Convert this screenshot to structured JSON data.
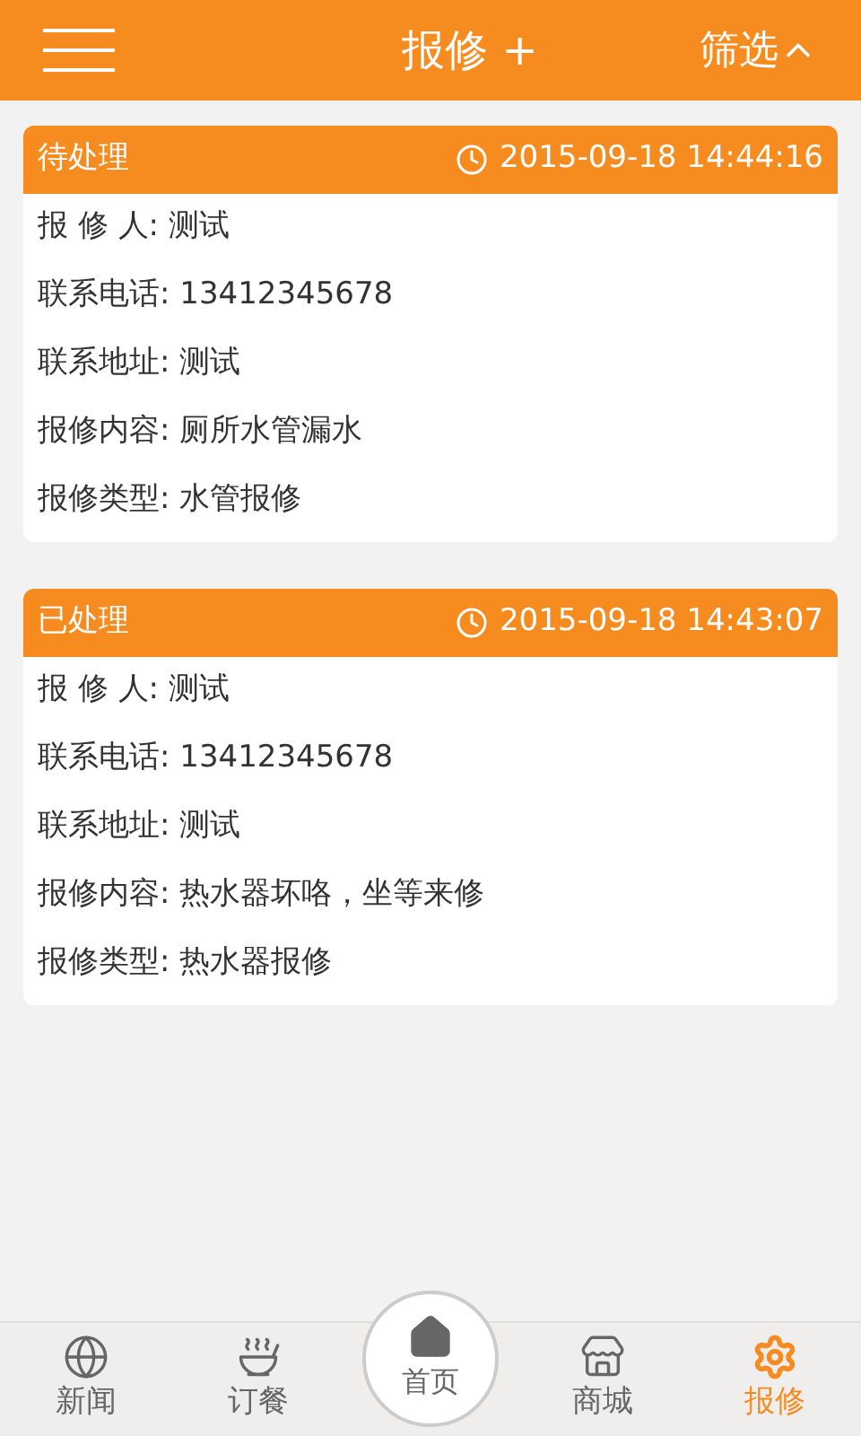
{
  "header": {
    "title": "报修 +",
    "filter": "筛选"
  },
  "orders": [
    {
      "status": "待处理",
      "time": "2015-09-18 14:44:16",
      "fields": [
        "报 修 人: 测试",
        "联系电话: 13412345678",
        "联系地址: 测试",
        "报修内容: 厕所水管漏水",
        "报修类型: 水管报修"
      ]
    },
    {
      "status": "已处理",
      "time": "2015-09-18 14:43:07",
      "fields": [
        "报 修 人: 测试",
        "联系电话: 13412345678",
        "联系地址: 测试",
        "报修内容: 热水器坏咯，坐等来修",
        "报修类型: 热水器报修"
      ]
    }
  ],
  "tabs": [
    {
      "kind": "globe",
      "label": "新闻",
      "selected": false
    },
    {
      "kind": "bowl",
      "label": "订餐",
      "selected": false
    },
    {
      "kind": "home",
      "label": "首页",
      "selected": false
    },
    {
      "kind": "shop",
      "label": "商城",
      "selected": false
    },
    {
      "kind": "gear",
      "label": "报修",
      "selected": true
    }
  ]
}
